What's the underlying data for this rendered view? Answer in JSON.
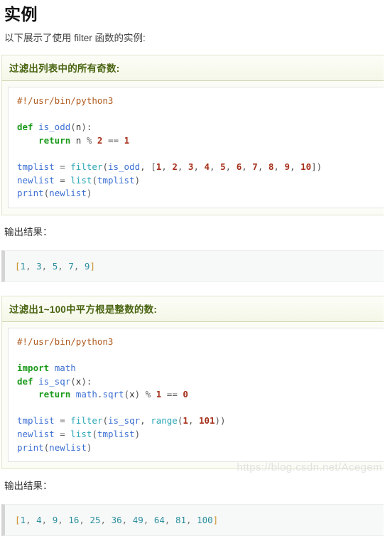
{
  "page": {
    "title": "实例",
    "intro": "以下展示了使用 filter 函数的实例:",
    "output_label_1": "输出结果：",
    "output_label_2": "输出结果：",
    "watermark": "https://blog.csdn.net/Acegem"
  },
  "examples": [
    {
      "heading": "过滤出列表中的所有奇数:",
      "language": "python",
      "code_lines": [
        "#!/usr/bin/python3",
        "",
        "def is_odd(n):",
        "    return n % 2 == 1",
        "",
        "tmplist = filter(is_odd, [1, 2, 3, 4, 5, 6, 7, 8, 9, 10])",
        "newlist = list(tmplist)",
        "print(newlist)"
      ],
      "output": "[1, 3, 5, 7, 9]"
    },
    {
      "heading": "过滤出1~100中平方根是整数的数:",
      "language": "python",
      "code_lines": [
        "#!/usr/bin/python3",
        "",
        "import math",
        "def is_sqr(x):",
        "    return math.sqrt(x) % 1 == 0",
        "",
        "tmplist = filter(is_sqr, range(1, 101))",
        "newlist = list(tmplist)",
        "print(newlist)"
      ],
      "output": "[1, 4, 9, 16, 25, 36, 49, 64, 81, 100]"
    }
  ],
  "colors": {
    "heading_green": "#4a6512",
    "box_border": "#dfe6c8",
    "box_background": "#fbfcf6",
    "keyword": "#1a9a1a",
    "function": "#3b6fd4",
    "builtin": "#2aa6b5",
    "number": "#a6301a",
    "comment": "#b05a1e",
    "output_number": "#2a8f9e",
    "output_bracket": "#c9932b",
    "output_background": "#f7f8f8",
    "output_border": "#d4d4d4"
  }
}
